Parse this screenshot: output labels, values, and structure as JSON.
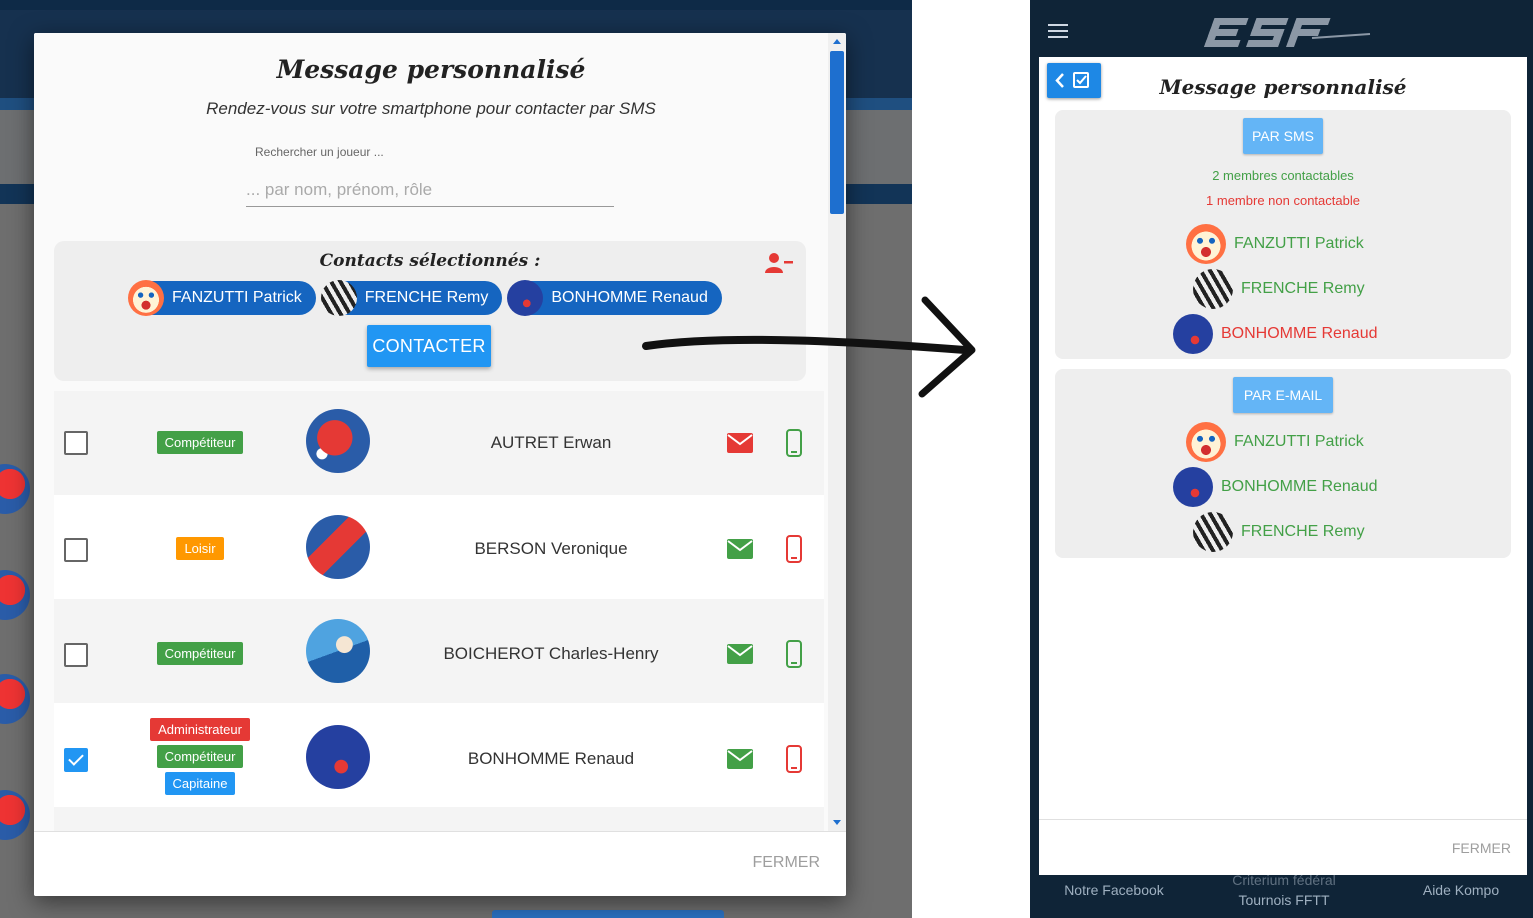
{
  "left_modal": {
    "title": "Message personnalisé",
    "subtitle": "Rendez-vous sur votre smartphone pour contacter par SMS",
    "search": {
      "label": "Rechercher un joueur ...",
      "placeholder": "... par nom, prénom, rôle"
    },
    "selected": {
      "title": "Contacts sélectionnés :",
      "remove_icon": "user-minus-icon",
      "chips": [
        {
          "name": "FANZUTTI Patrick",
          "avatar": "clown"
        },
        {
          "name": "FRENCHE Remy",
          "avatar": "zebra"
        },
        {
          "name": "BONHOMME Renaud",
          "avatar": "pingpong-logo"
        }
      ],
      "contact_button": "CONTACTER"
    },
    "rows": [
      {
        "name": "AUTRET Erwan",
        "checked": false,
        "badges": [
          {
            "label": "Compétiteur",
            "color": "green"
          }
        ],
        "mail_status": "red",
        "phone_status": "green"
      },
      {
        "name": "BERSON Veronique",
        "checked": false,
        "badges": [
          {
            "label": "Loisir",
            "color": "orange"
          }
        ],
        "mail_status": "green",
        "phone_status": "red"
      },
      {
        "name": "BOICHEROT Charles-Henry",
        "checked": false,
        "badges": [
          {
            "label": "Compétiteur",
            "color": "green"
          }
        ],
        "mail_status": "green",
        "phone_status": "green"
      },
      {
        "name": "BONHOMME Renaud",
        "checked": true,
        "badges": [
          {
            "label": "Administrateur",
            "color": "red"
          },
          {
            "label": "Compétiteur",
            "color": "green"
          },
          {
            "label": "Capitaine",
            "color": "blue"
          }
        ],
        "mail_status": "green",
        "phone_status": "red"
      }
    ],
    "close_label": "FERMER"
  },
  "right_modal": {
    "title": "Message personnalisé",
    "back_icon": "chevron-left-icon",
    "sms": {
      "button": "PAR SMS",
      "count_ok": "2 membres contactables",
      "count_ko": "1 membre non contactable",
      "members": [
        {
          "name": "FANZUTTI Patrick",
          "status": "ok",
          "avatar": "clown"
        },
        {
          "name": "FRENCHE Remy",
          "status": "ok",
          "avatar": "zebra"
        },
        {
          "name": "BONHOMME Renaud",
          "status": "ko",
          "avatar": "pingpong-logo"
        }
      ]
    },
    "email": {
      "button": "PAR E-MAIL",
      "members": [
        {
          "name": "FANZUTTI Patrick",
          "status": "ok",
          "avatar": "clown"
        },
        {
          "name": "BONHOMME Renaud",
          "status": "ok",
          "avatar": "pingpong-logo"
        },
        {
          "name": "FRENCHE Remy",
          "status": "ok",
          "avatar": "zebra"
        }
      ]
    },
    "close_label": "FERMER"
  },
  "mobile_footer": {
    "links": [
      "Notre Facebook",
      "Criterium fédéral",
      "Tournois FFTT",
      "Aide Kompo"
    ]
  },
  "colors": {
    "primary": "#2196f3",
    "ok": "#43a047",
    "ko": "#e53935",
    "chip": "#1565c0"
  }
}
